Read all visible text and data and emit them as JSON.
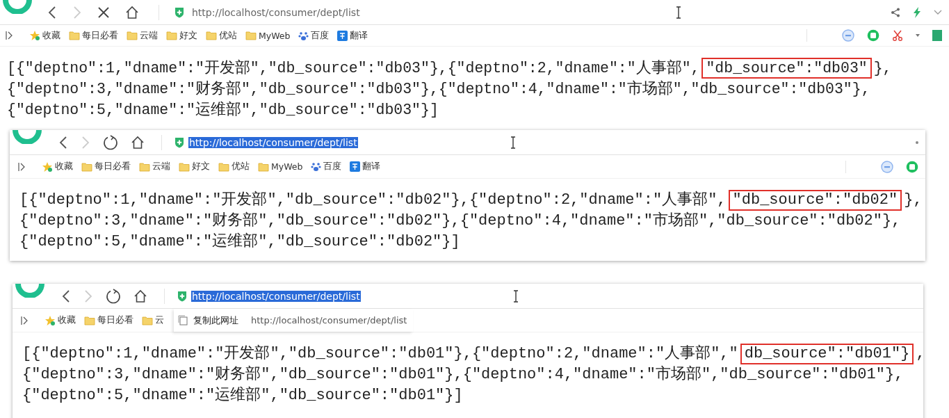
{
  "windows": [
    {
      "loading": true,
      "url_selected": false,
      "url": "http://localhost/consumer/dept/list",
      "forward_disabled": true,
      "bookmarks": [
        {
          "label": "收藏",
          "kind": "star"
        },
        {
          "label": "每日必看",
          "kind": "folder"
        },
        {
          "label": "云端",
          "kind": "folder"
        },
        {
          "label": "好文",
          "kind": "folder"
        },
        {
          "label": "优站",
          "kind": "folder"
        },
        {
          "label": "MyWeb",
          "kind": "folder"
        },
        {
          "label": "百度",
          "kind": "paw"
        },
        {
          "label": "翻译",
          "kind": "translate"
        }
      ],
      "lines": [
        [
          {
            "text": "[{\"deptno\":1,\"dname\":\"开发部\",\"db_source\":\"db03\"},{\"deptno\":2,\"dname\":\"人事部\",",
            "highlighted": false
          },
          {
            "text": "\"db_source\":\"db03\"",
            "highlighted": true
          },
          {
            "text": "},",
            "highlighted": false
          }
        ],
        [
          {
            "text": "{\"deptno\":3,\"dname\":\"财务部\",\"db_source\":\"db03\"},{\"deptno\":4,\"dname\":\"市场部\",\"db_source\":\"db03\"},",
            "highlighted": false
          }
        ],
        [
          {
            "text": "{\"deptno\":5,\"dname\":\"运维部\",\"db_source\":\"db03\"}]",
            "highlighted": false
          }
        ]
      ]
    },
    {
      "loading": false,
      "url_selected": true,
      "url": "http://localhost/consumer/dept/list",
      "forward_disabled": true,
      "bookmarks": [
        {
          "label": "收藏",
          "kind": "star"
        },
        {
          "label": "每日必看",
          "kind": "folder"
        },
        {
          "label": "云端",
          "kind": "folder"
        },
        {
          "label": "好文",
          "kind": "folder"
        },
        {
          "label": "优站",
          "kind": "folder"
        },
        {
          "label": "MyWeb",
          "kind": "folder"
        },
        {
          "label": "百度",
          "kind": "paw"
        },
        {
          "label": "翻译",
          "kind": "translate"
        }
      ],
      "lines": [
        [
          {
            "text": "[{\"deptno\":1,\"dname\":\"开发部\",\"db_source\":\"db02\"},{\"deptno\":2,\"dname\":\"人事部\",",
            "highlighted": false
          },
          {
            "text": "\"db_source\":\"db02\"",
            "highlighted": true
          },
          {
            "text": "},",
            "highlighted": false
          }
        ],
        [
          {
            "text": "{\"deptno\":3,\"dname\":\"财务部\",\"db_source\":\"db02\"},{\"deptno\":4,\"dname\":\"市场部\",\"db_source\":\"db02\"},",
            "highlighted": false
          }
        ],
        [
          {
            "text": "{\"deptno\":5,\"dname\":\"运维部\",\"db_source\":\"db02\"}]",
            "highlighted": false
          }
        ]
      ]
    },
    {
      "loading": false,
      "url_selected": true,
      "url": "http://localhost/consumer/dept/list",
      "forward_disabled": true,
      "bookmarks": [
        {
          "label": "收藏",
          "kind": "star"
        },
        {
          "label": "每日必看",
          "kind": "folder"
        },
        {
          "label": "云",
          "kind": "folder"
        }
      ],
      "popup": {
        "item": "复制此网址",
        "url": "http://localhost/consumer/dept/list"
      },
      "lines": [
        [
          {
            "text": "[{\"deptno\":1,\"dname\":\"开发部\",\"db_source\":\"db01\"},{\"deptno\":2,\"dname\":\"人事部\",\"",
            "highlighted": false
          },
          {
            "text": "db_source\":\"db01\"}",
            "highlighted": true
          },
          {
            "text": ",",
            "highlighted": false
          }
        ],
        [
          {
            "text": "{\"deptno\":3,\"dname\":\"财务部\",\"db_source\":\"db01\"},{\"deptno\":4,\"dname\":\"市场部\",\"db_source\":\"db01\"},",
            "highlighted": false
          }
        ],
        [
          {
            "text": "{\"deptno\":5,\"dname\":\"运维部\",\"db_source\":\"db01\"}]",
            "highlighted": false
          }
        ]
      ]
    }
  ]
}
